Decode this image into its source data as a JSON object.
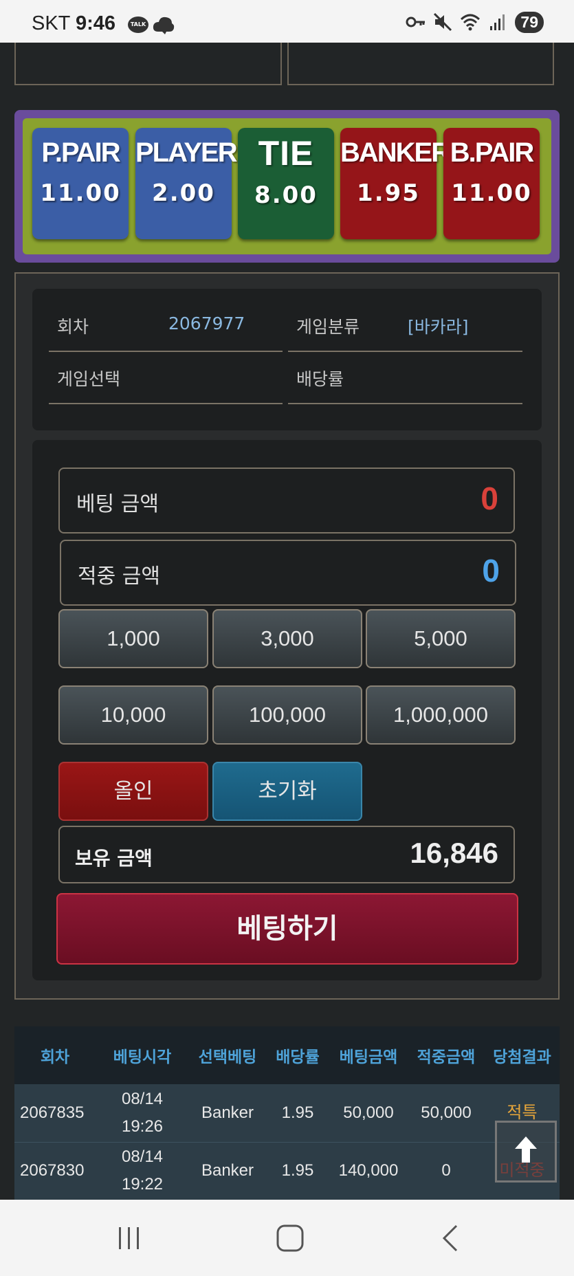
{
  "status_bar": {
    "carrier": "SKT",
    "time": "9:46",
    "talk_badge": "TALK",
    "battery": "79",
    "icons": [
      "kakaotalk-icon",
      "cloud-icon",
      "key-icon",
      "mute-icon",
      "wifi-icon",
      "signal-icon"
    ]
  },
  "odds": [
    {
      "name": "P.PAIR",
      "value": "11.00",
      "color": "#3b5ea6"
    },
    {
      "name": "PLAYER",
      "value": "2.00",
      "color": "#3b5ea6"
    },
    {
      "name": "TIE",
      "value": "8.00",
      "color": "#1b5e35"
    },
    {
      "name": "BANKER",
      "value": "1.95",
      "color": "#951519"
    },
    {
      "name": "B.PAIR",
      "value": "11.00",
      "color": "#951519"
    }
  ],
  "info": {
    "round_label": "회차",
    "round_value": "2067977",
    "category_label": "게임분류",
    "category_value": "[바카라]",
    "selection_label": "게임선택",
    "selection_value": "",
    "payout_label": "배당률",
    "payout_value": ""
  },
  "bet": {
    "bet_amount_label": "베팅 금액",
    "bet_amount_value": "0",
    "win_amount_label": "적중 금액",
    "win_amount_value": "0",
    "chips": [
      "1,000",
      "3,000",
      "5,000",
      "10,000",
      "100,000",
      "1,000,000"
    ],
    "all_in_label": "올인",
    "reset_label": "초기화",
    "holding_label": "보유 금액",
    "holding_value": "16,846",
    "submit_label": "베팅하기"
  },
  "history": {
    "columns": [
      "회차",
      "베팅시각",
      "선택베팅",
      "배당률",
      "베팅금액",
      "적중금액",
      "당첨결과"
    ],
    "rows": [
      {
        "round": "2067835",
        "date": "08/14",
        "time": "19:26",
        "pick": "Banker",
        "odds": "1.95",
        "bet": "50,000",
        "win": "50,000",
        "result": "적특"
      },
      {
        "round": "2067830",
        "date": "08/14",
        "time": "19:22",
        "pick": "Banker",
        "odds": "1.95",
        "bet": "140,000",
        "win": "0",
        "result": "미적중"
      }
    ]
  },
  "colors": {
    "accent_blue": "#4ea3d9",
    "bet_amount": "#d9413a",
    "win_amount": "#4ea3e9"
  },
  "nav": [
    "recent-apps-icon",
    "home-icon",
    "back-icon"
  ]
}
